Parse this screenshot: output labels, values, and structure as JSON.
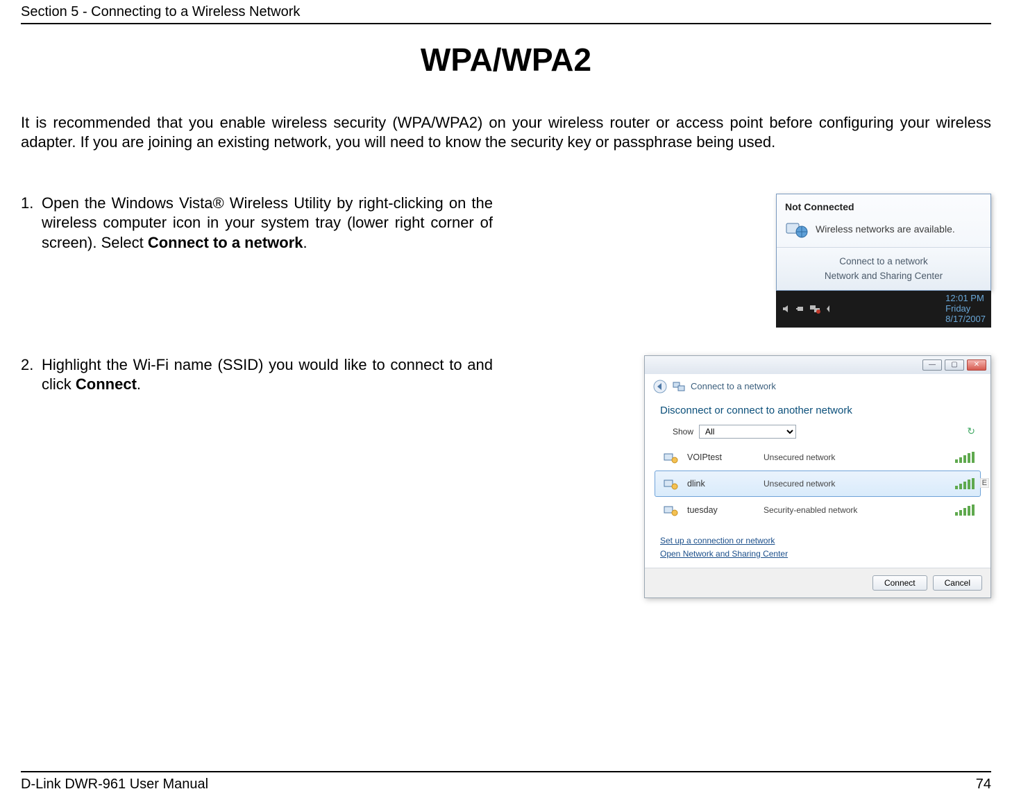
{
  "section_header": "Section 5 - Connecting to a Wireless Network",
  "title": "WPA/WPA2",
  "intro": "It is recommended that you enable wireless security (WPA/WPA2) on your wireless router or access point before configuring your wireless adapter. If you are joining an existing network, you will need to know the security key or passphrase being used.",
  "steps": [
    {
      "num": "1.",
      "text_pre": "Open the Windows Vista® Wireless Utility by right-clicking on the wireless computer icon in your system tray (lower right corner of screen). Select ",
      "bold": "Connect to a network",
      "text_post": "."
    },
    {
      "num": "2.",
      "text_pre": "Highlight the Wi-Fi name (SSID) you would like to connect to and click ",
      "bold": "Connect",
      "text_post": "."
    }
  ],
  "popup": {
    "status": "Not Connected",
    "avail": "Wireless networks are available.",
    "link1": "Connect to a network",
    "link2": "Network and Sharing Center"
  },
  "tray": {
    "time": "12:01 PM",
    "day": "Friday",
    "date": "8/17/2007"
  },
  "dialog": {
    "crumb": "Connect to a network",
    "subtitle": "Disconnect or connect to another network",
    "show_label": "Show",
    "show_value": "All",
    "networks": [
      {
        "name": "VOIPtest",
        "sec": "Unsecured network",
        "selected": false
      },
      {
        "name": "dlink",
        "sec": "Unsecured network",
        "selected": true
      },
      {
        "name": "tuesday",
        "sec": "Security-enabled network",
        "selected": false
      }
    ],
    "link_setup": "Set up a connection or network",
    "link_center": "Open Network and Sharing Center",
    "btn_connect": "Connect",
    "btn_cancel": "Cancel",
    "scroll_mark": "E"
  },
  "footer": {
    "manual": "D-Link DWR-961 User Manual",
    "page": "74"
  }
}
